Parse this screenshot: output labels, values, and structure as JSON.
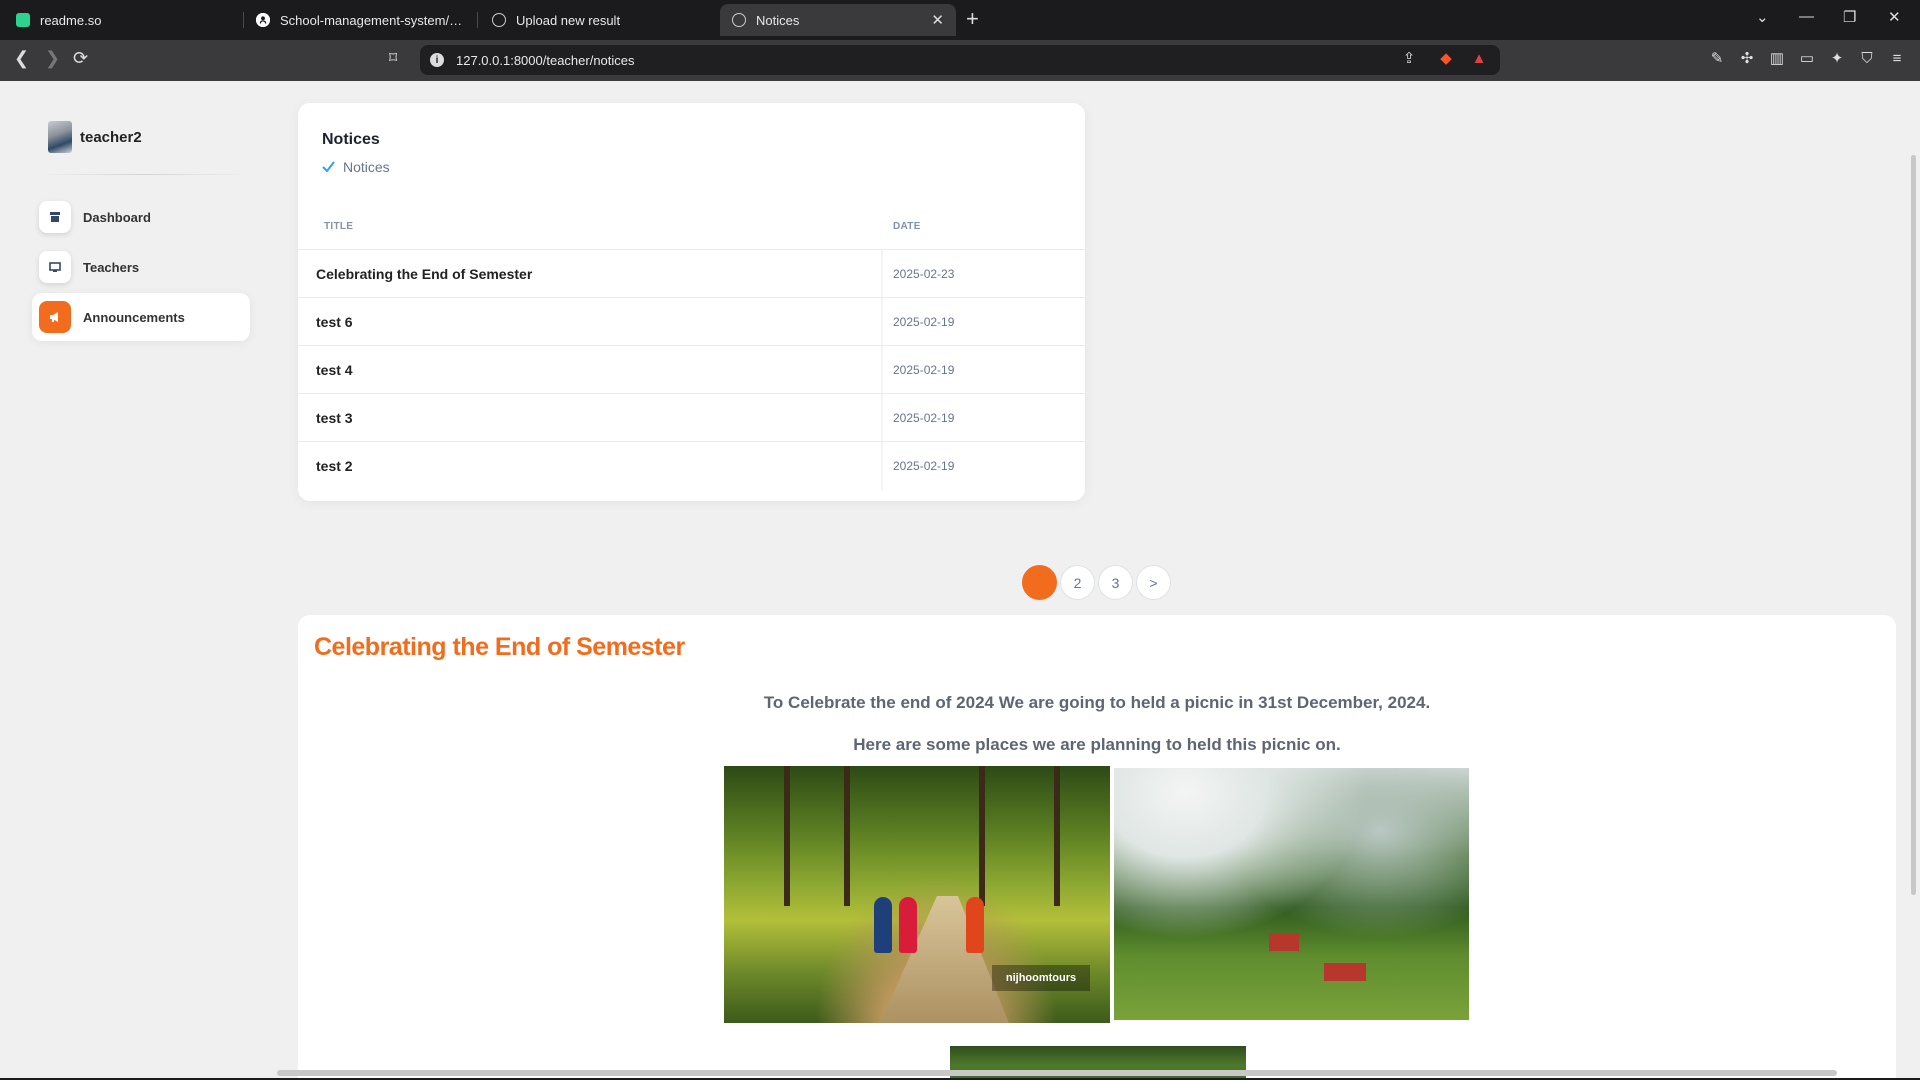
{
  "browser": {
    "tabs": [
      {
        "label": "readme.so",
        "icon": "readme-favicon",
        "color": "#2ed18f"
      },
      {
        "label": "School-management-system/Demo",
        "icon": "github-icon"
      },
      {
        "label": "Upload new result",
        "icon": "globe-icon"
      },
      {
        "label": "Notices",
        "icon": "globe-icon",
        "active": true
      }
    ],
    "url": "127.0.0.1:8000/teacher/notices"
  },
  "sidebar": {
    "user_name": "teacher2",
    "items": [
      {
        "label": "Dashboard",
        "icon": "shop-icon"
      },
      {
        "label": "Teachers",
        "icon": "presentation-icon"
      },
      {
        "label": "Announcements",
        "icon": "megaphone-icon",
        "active": true
      }
    ]
  },
  "notices_card": {
    "title": "Notices",
    "subtitle": "Notices",
    "columns": {
      "title": "TITLE",
      "date": "DATE"
    },
    "rows": [
      {
        "title": "Celebrating the End of Semester",
        "date": "2025-02-23"
      },
      {
        "title": "test 6",
        "date": "2025-02-19"
      },
      {
        "title": "test 4",
        "date": "2025-02-19"
      },
      {
        "title": "test 3",
        "date": "2025-02-19"
      },
      {
        "title": "test 2",
        "date": "2025-02-19"
      }
    ]
  },
  "pagination": {
    "pages": [
      "1",
      "2",
      "3"
    ],
    "current": "1",
    "next": ">"
  },
  "notice_detail": {
    "title": "Celebrating the End of Semester",
    "lines": [
      "To Celebrate the end of 2024 We are going to held a picnic in 31st December, 2024.",
      "Here are some places we are planning to held this picnic on."
    ],
    "photo_watermark": "nijhoomtours"
  },
  "colors": {
    "accent": "#f26c1d",
    "check": "#2aa3ff",
    "muted_text": "#67748e"
  }
}
